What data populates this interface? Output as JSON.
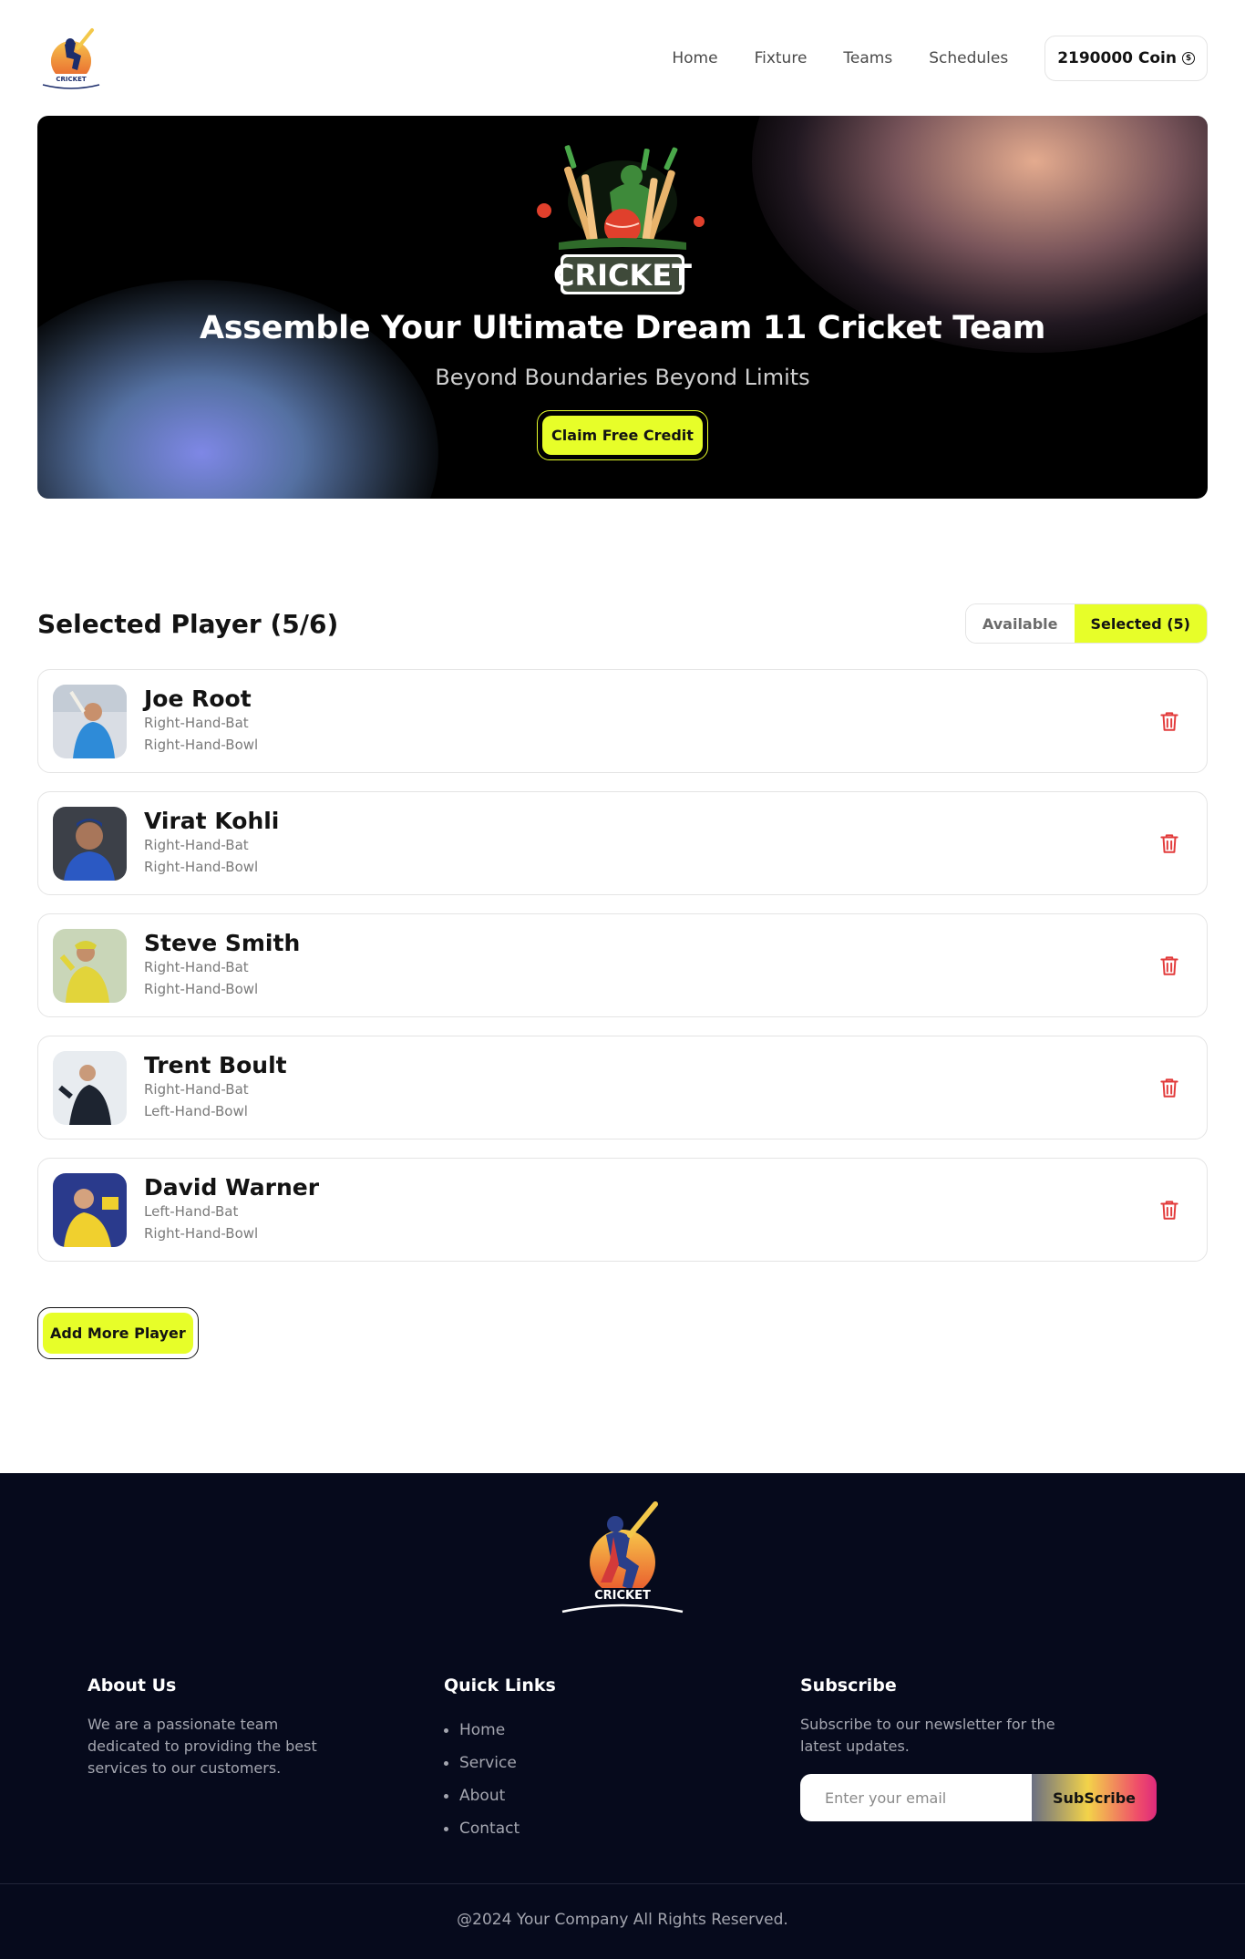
{
  "nav": {
    "logo_text": "CRICKET",
    "links": [
      "Home",
      "Fixture",
      "Teams",
      "Schedules"
    ],
    "coin_label": "2190000 Coin"
  },
  "hero": {
    "logo_text": "CRICKET",
    "title": "Assemble Your Ultimate Dream 11 Cricket Team",
    "subtitle": "Beyond Boundaries Beyond Limits",
    "cta_label": "Claim Free Credit"
  },
  "selected": {
    "title": "Selected Player (5/6)",
    "toggle_available": "Available",
    "toggle_selected": "Selected (5)",
    "players": [
      {
        "name": "Joe Root",
        "bat": "Right-Hand-Bat",
        "bowl": "Right-Hand-Bowl"
      },
      {
        "name": "Virat Kohli",
        "bat": "Right-Hand-Bat",
        "bowl": "Right-Hand-Bowl"
      },
      {
        "name": "Steve Smith",
        "bat": "Right-Hand-Bat",
        "bowl": "Right-Hand-Bowl"
      },
      {
        "name": "Trent Boult",
        "bat": "Right-Hand-Bat",
        "bowl": "Left-Hand-Bowl"
      },
      {
        "name": "David Warner",
        "bat": "Left-Hand-Bat",
        "bowl": "Right-Hand-Bowl"
      }
    ],
    "add_more_label": "Add More Player"
  },
  "footer": {
    "logo_text": "CRICKET",
    "about_title": "About Us",
    "about_text": "We are a passionate team dedicated to providing the best services to our customers.",
    "links_title": "Quick Links",
    "links": [
      "Home",
      "Service",
      "About",
      "Contact"
    ],
    "subscribe_title": "Subscribe",
    "subscribe_text": "Subscribe to our newsletter for the latest updates.",
    "email_placeholder": "Enter your email",
    "subscribe_button": "SubScribe",
    "copyright": "@2024 Your Company All Rights Reserved."
  },
  "colors": {
    "accent": "#e7fe29",
    "footer_bg": "#060a1c",
    "trash": "#e23b3b"
  }
}
